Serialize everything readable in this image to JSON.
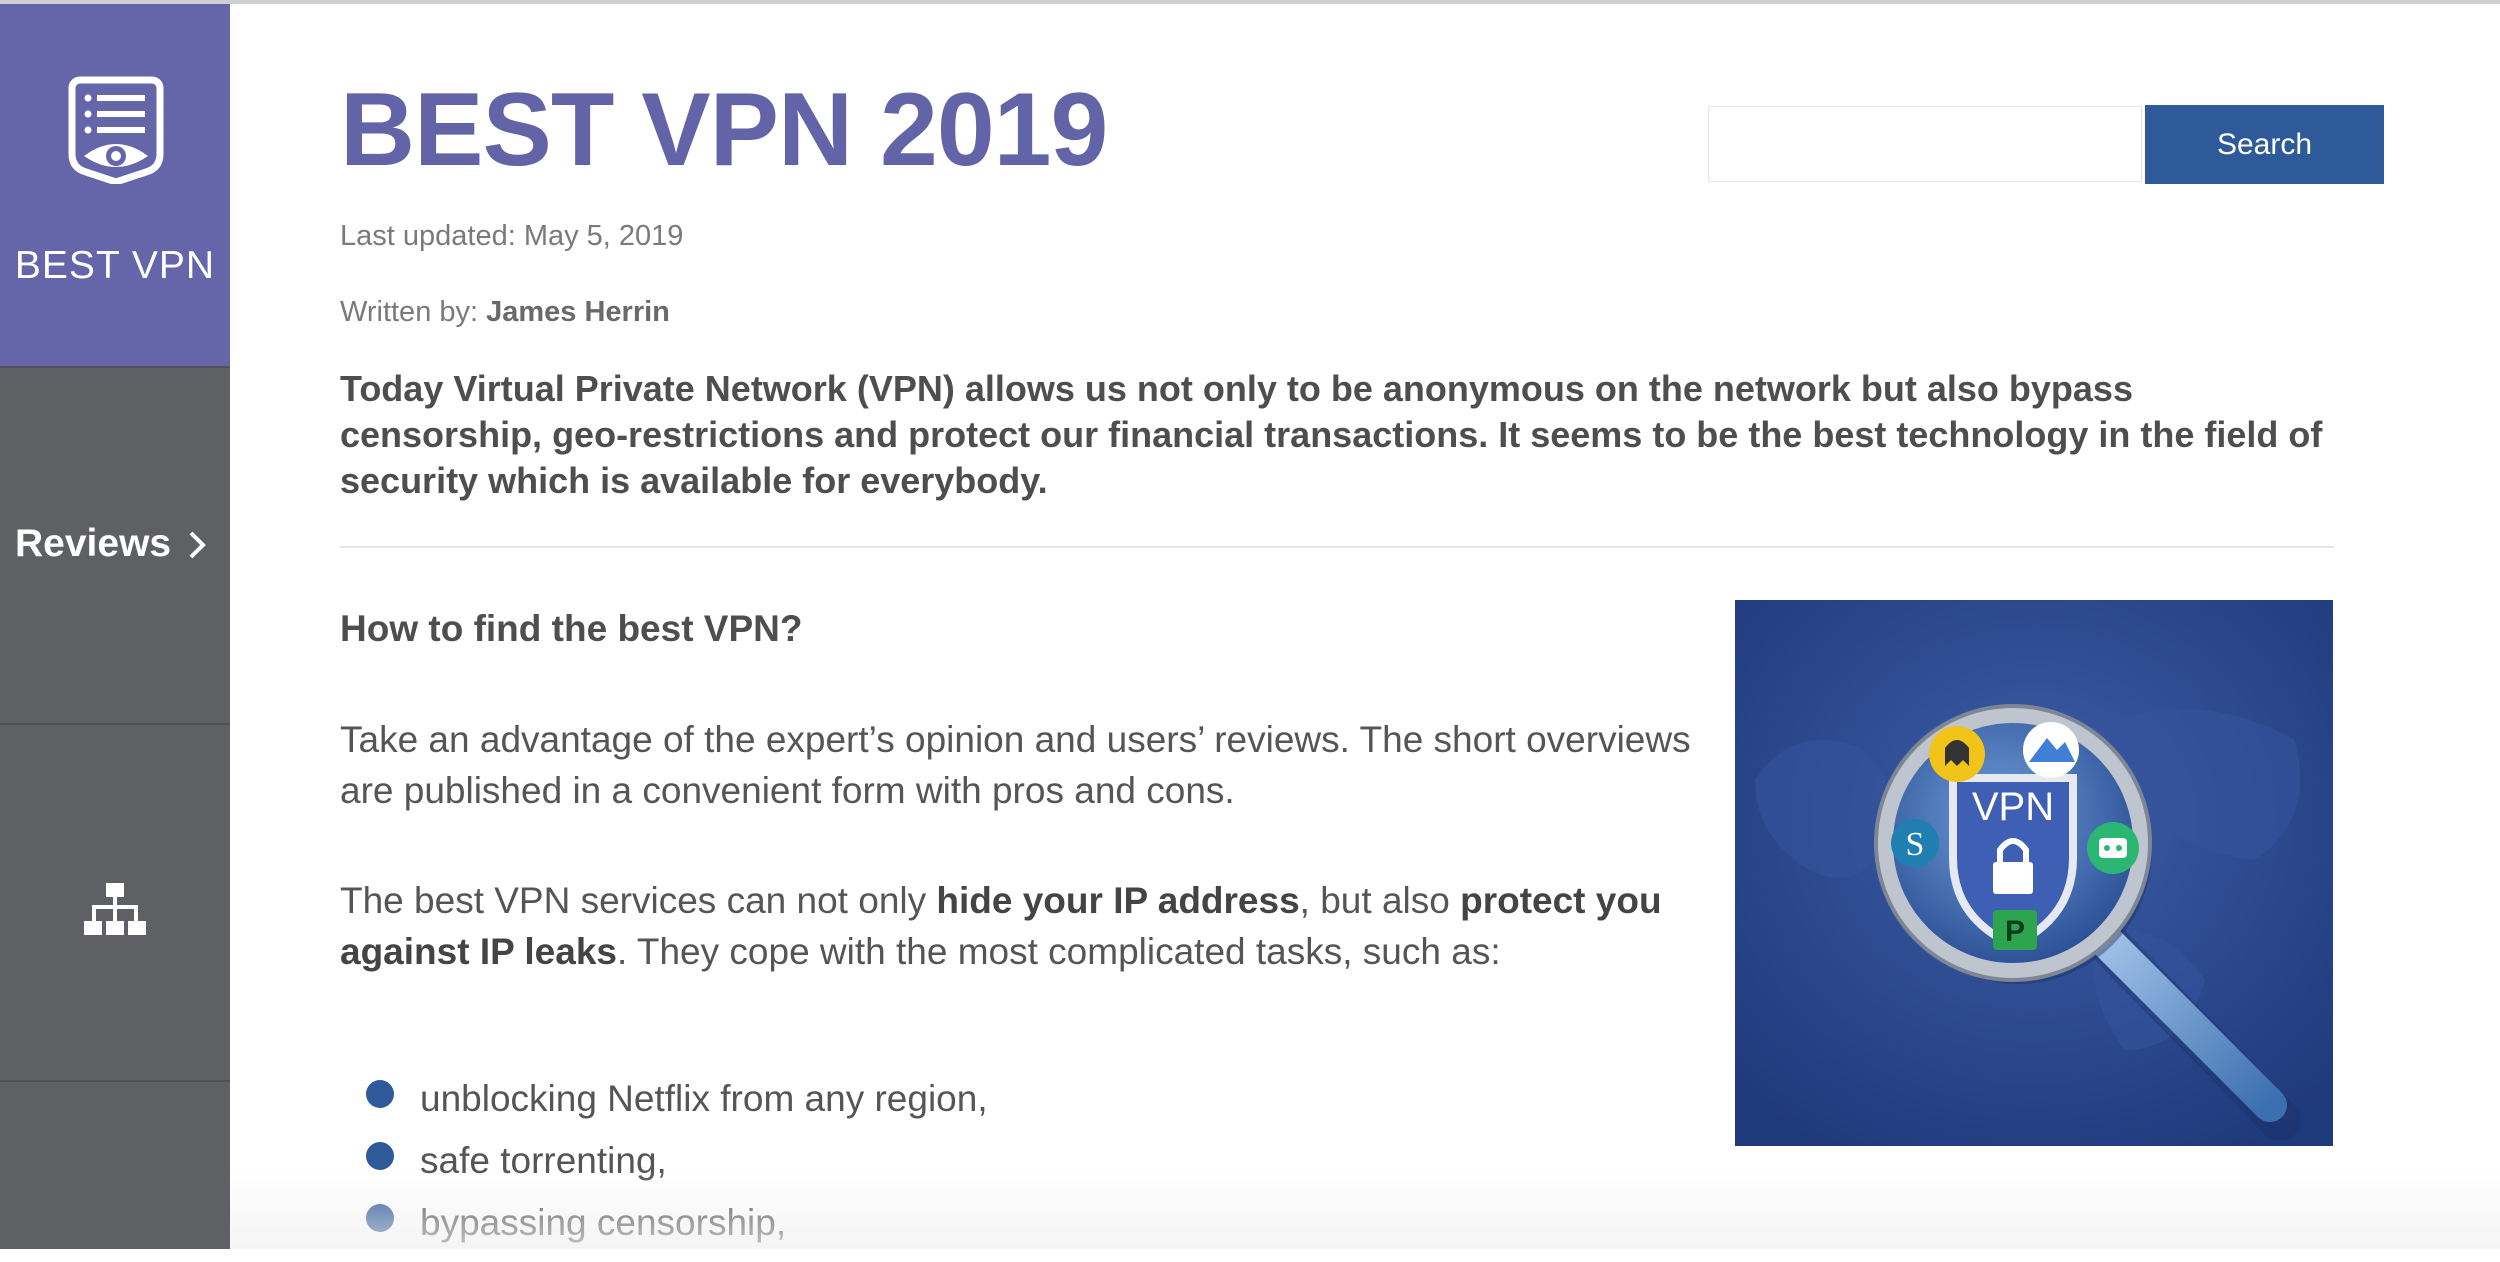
{
  "sidebar": {
    "brand": "BEST VPN",
    "reviews_label": "Reviews"
  },
  "header": {
    "title": "BEST VPN 2019",
    "search_placeholder": "",
    "search_button": "Search"
  },
  "meta": {
    "updated": "Last updated: May 5, 2019",
    "written_prefix": "Written by:",
    "author": "James Herrin"
  },
  "intro": "Today Virtual Private Network (VPN) allows us not only to be anonymous on the network but also bypass censorship, geo-restrictions and protect our financial transactions. It seems to be the best technology in the field of security which is available for everybody.",
  "section": {
    "heading": "How to find the best VPN?",
    "p1": "Take an advantage of the expert’s opinion and users’ reviews. The short overviews are published in a convenient form with pros and cons.",
    "p2": {
      "t1": "The best VPN services can not only ",
      "b1": "hide your IP address",
      "t2": ", but also ",
      "b2": "protect you against IP leaks",
      "t3": ". They cope with the most complicated tasks, such as:"
    },
    "list": [
      "unblocking Netflix from any region,",
      "safe torrenting,",
      "bypassing censorship,"
    ]
  },
  "hero": {
    "badge": "VPN"
  },
  "colors": {
    "brand": "#6566a9",
    "sidebar": "#5e6064",
    "accent": "#2f5a9a",
    "title": "#6264a7"
  }
}
